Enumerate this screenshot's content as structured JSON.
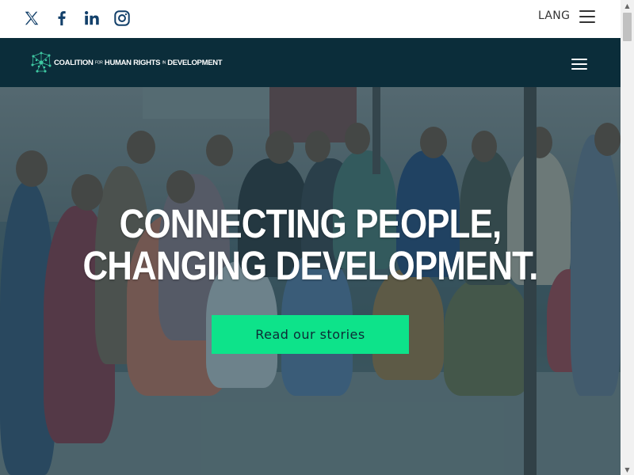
{
  "topbar": {
    "social": [
      {
        "icon": "x-twitter-icon",
        "glyph": "𝕏"
      },
      {
        "icon": "facebook-icon",
        "glyph": "f"
      },
      {
        "icon": "linkedin-icon",
        "glyph": "in"
      },
      {
        "icon": "instagram-icon",
        "glyph": "◎"
      }
    ],
    "lang_label": "LANG",
    "menu_icon": "hamburger-menu-icon"
  },
  "navbar": {
    "logo": {
      "icon": "network-logo-icon",
      "word1": "COALITION",
      "word2": "FOR",
      "word3": "HUMAN RIGHTS",
      "word4": "IN",
      "word5": "DEVELOPMENT"
    },
    "menu_icon": "hamburger-menu-icon"
  },
  "hero": {
    "headline_line1": "CONNECTING PEOPLE,",
    "headline_line2": "CHANGING DEVELOPMENT.",
    "cta_label": "Read our stories"
  },
  "colors": {
    "nav_bg": "#0b2d3a",
    "cta_bg": "#0de38a",
    "social_icon": "#13406a"
  },
  "scrollbar": {
    "up_icon": "scroll-up-arrow-icon",
    "down_icon": "scroll-down-arrow-icon"
  }
}
